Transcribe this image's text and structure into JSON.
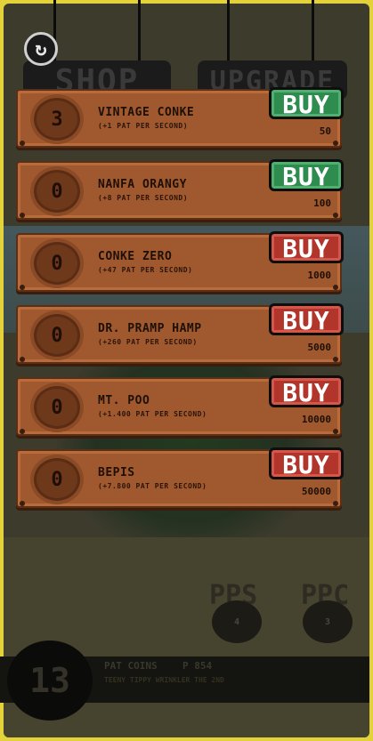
{
  "tabs": {
    "shop": "SHOP",
    "upgrade": "UPGRADE"
  },
  "refresh_icon": "refresh-icon",
  "items": [
    {
      "count": "3",
      "name": "VINTAGE CONKE",
      "sub": "(+1 PAT PER SECOND)",
      "price": "50",
      "buy": "BUY",
      "buy_color": "#2e8c4f",
      "affordable": true
    },
    {
      "count": "0",
      "name": "NANFA ORANGY",
      "sub": "(+8 PAT PER SECOND)",
      "price": "100",
      "buy": "BUY",
      "buy_color": "#2e8c4f",
      "affordable": true
    },
    {
      "count": "0",
      "name": "CONKE ZERO",
      "sub": "(+47 PAT PER SECOND)",
      "price": "1000",
      "buy": "BUY",
      "buy_color": "#b2352c",
      "affordable": false
    },
    {
      "count": "0",
      "name": "DR. PRAMP HAMP",
      "sub": "(+260 PAT PER SECOND)",
      "price": "5000",
      "buy": "BUY",
      "buy_color": "#b2352c",
      "affordable": false
    },
    {
      "count": "0",
      "name": "MT. POO",
      "sub": "(+1.400 PAT PER SECOND)",
      "price": "10000",
      "buy": "BUY",
      "buy_color": "#b2352c",
      "affordable": false
    },
    {
      "count": "0",
      "name": "BEPIS",
      "sub": "(+7.800 PAT PER SECOND)",
      "price": "50000",
      "buy": "BUY",
      "buy_color": "#b2352c",
      "affordable": false
    }
  ],
  "stats": {
    "pps_label": "PPS",
    "pps_value": "4",
    "ppc_label": "PPC",
    "ppc_value": "3"
  },
  "footer": {
    "level": "13",
    "coins_label": "PAT COINS",
    "coins_value": "P 854",
    "dog_name": "TEENY TIPPY WRINKLER THE 2ND"
  }
}
